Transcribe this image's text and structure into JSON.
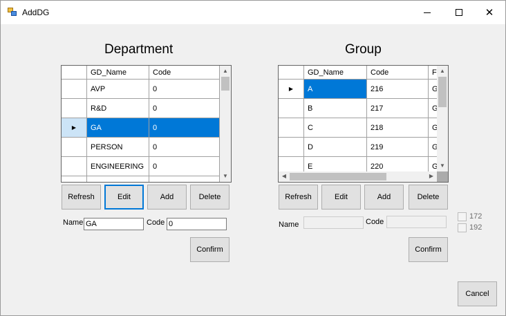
{
  "window": {
    "title": "AddDG"
  },
  "department": {
    "heading": "Department",
    "columns": [
      "GD_Name",
      "Code"
    ],
    "rows": [
      {
        "name": "AVP",
        "code": "0"
      },
      {
        "name": "R&D",
        "code": "0"
      },
      {
        "name": "GA",
        "code": "0"
      },
      {
        "name": "PERSON",
        "code": "0"
      },
      {
        "name": "ENGINEERING",
        "code": "0"
      }
    ],
    "buttons": {
      "refresh": "Refresh",
      "edit": "Edit",
      "add": "Add",
      "delete": "Delete",
      "confirm": "Confirm"
    },
    "name_label": "Name",
    "name_value": "GA",
    "code_label": "Code",
    "code_value": "0"
  },
  "group": {
    "heading": "Group",
    "columns": [
      "GD_Name",
      "Code",
      "F"
    ],
    "rows": [
      {
        "name": "A",
        "code": "216",
        "extra": "G"
      },
      {
        "name": "B",
        "code": "217",
        "extra": "G"
      },
      {
        "name": "C",
        "code": "218",
        "extra": "G"
      },
      {
        "name": "D",
        "code": "219",
        "extra": "G"
      },
      {
        "name": "E",
        "code": "220",
        "extra": "G"
      }
    ],
    "buttons": {
      "refresh": "Refresh",
      "edit": "Edit",
      "add": "Add",
      "delete": "Delete",
      "confirm": "Confirm"
    },
    "name_label": "Name",
    "code_label": "Code",
    "checkboxes": [
      "172",
      "192"
    ]
  },
  "cancel_label": "Cancel"
}
